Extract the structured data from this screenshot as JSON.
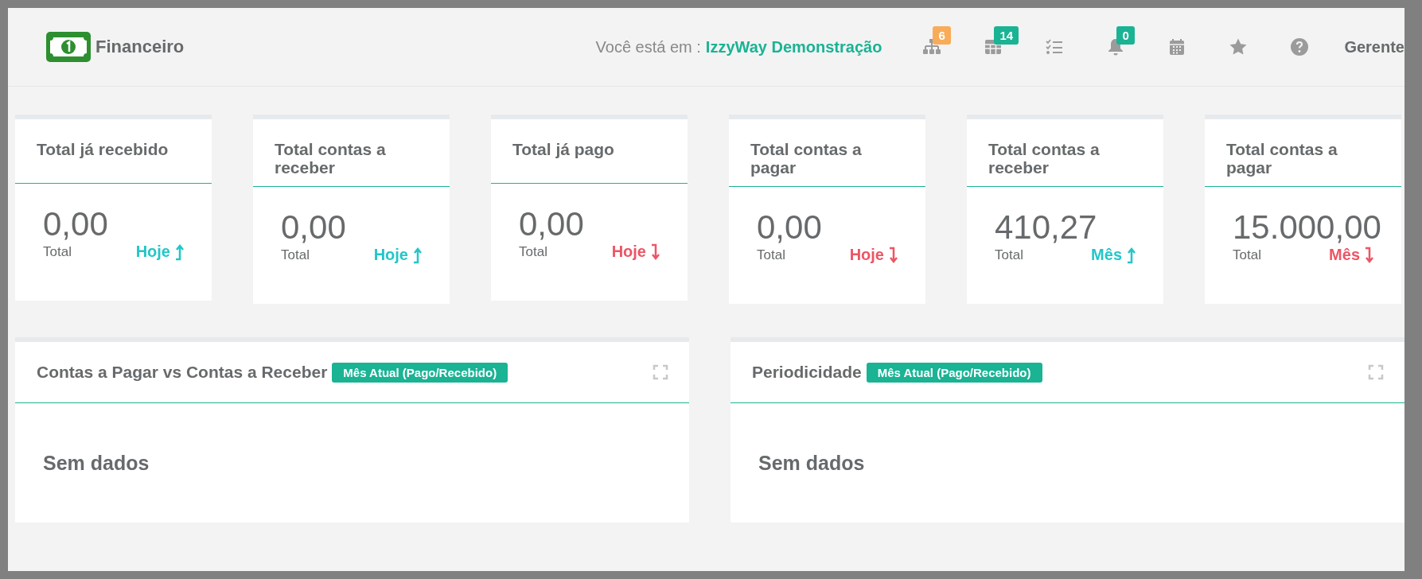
{
  "header": {
    "title": "Financeiro",
    "location_label": "Você está em :",
    "location": "IzzyWay Demonstração",
    "icons": [
      {
        "kind": "sitemap",
        "badge": "6",
        "color": "#f8ac59"
      },
      {
        "kind": "table",
        "badge": "14",
        "color": "#1ab394"
      },
      {
        "kind": "tasks"
      },
      {
        "kind": "bell",
        "badge": "0",
        "color": "#1ab394"
      },
      {
        "kind": "calendar"
      },
      {
        "kind": "star"
      },
      {
        "kind": "help"
      }
    ],
    "user": "Gerente"
  },
  "cards": [
    {
      "title": "Total já recebido",
      "value": "0,00",
      "caption": "Total",
      "period": "Hoje",
      "rising": true
    },
    {
      "title": "Total contas a receber",
      "value": "0,00",
      "caption": "Total",
      "period": "Hoje",
      "rising": true
    },
    {
      "title": "Total já pago",
      "value": "0,00",
      "caption": "Total",
      "period": "Hoje",
      "rising": false
    },
    {
      "title": "Total contas a pagar",
      "value": "0,00",
      "caption": "Total",
      "period": "Hoje",
      "rising": false
    },
    {
      "title": "Total contas a receber",
      "value": "410,27",
      "caption": "Total",
      "period": "Mês",
      "rising": true
    },
    {
      "title": "Total contas a pagar",
      "value": "15.000,00",
      "caption": "Total",
      "period": "Mês",
      "rising": false
    }
  ],
  "panels": [
    {
      "title": "Contas a Pagar vs Contas a Receber",
      "badge": "Mês Atual (Pago/Recebido)",
      "empty_text": "Sem dados"
    },
    {
      "title": "Periodicidade",
      "badge": "Mês Atual (Pago/Recebido)",
      "empty_text": "Sem dados"
    }
  ]
}
